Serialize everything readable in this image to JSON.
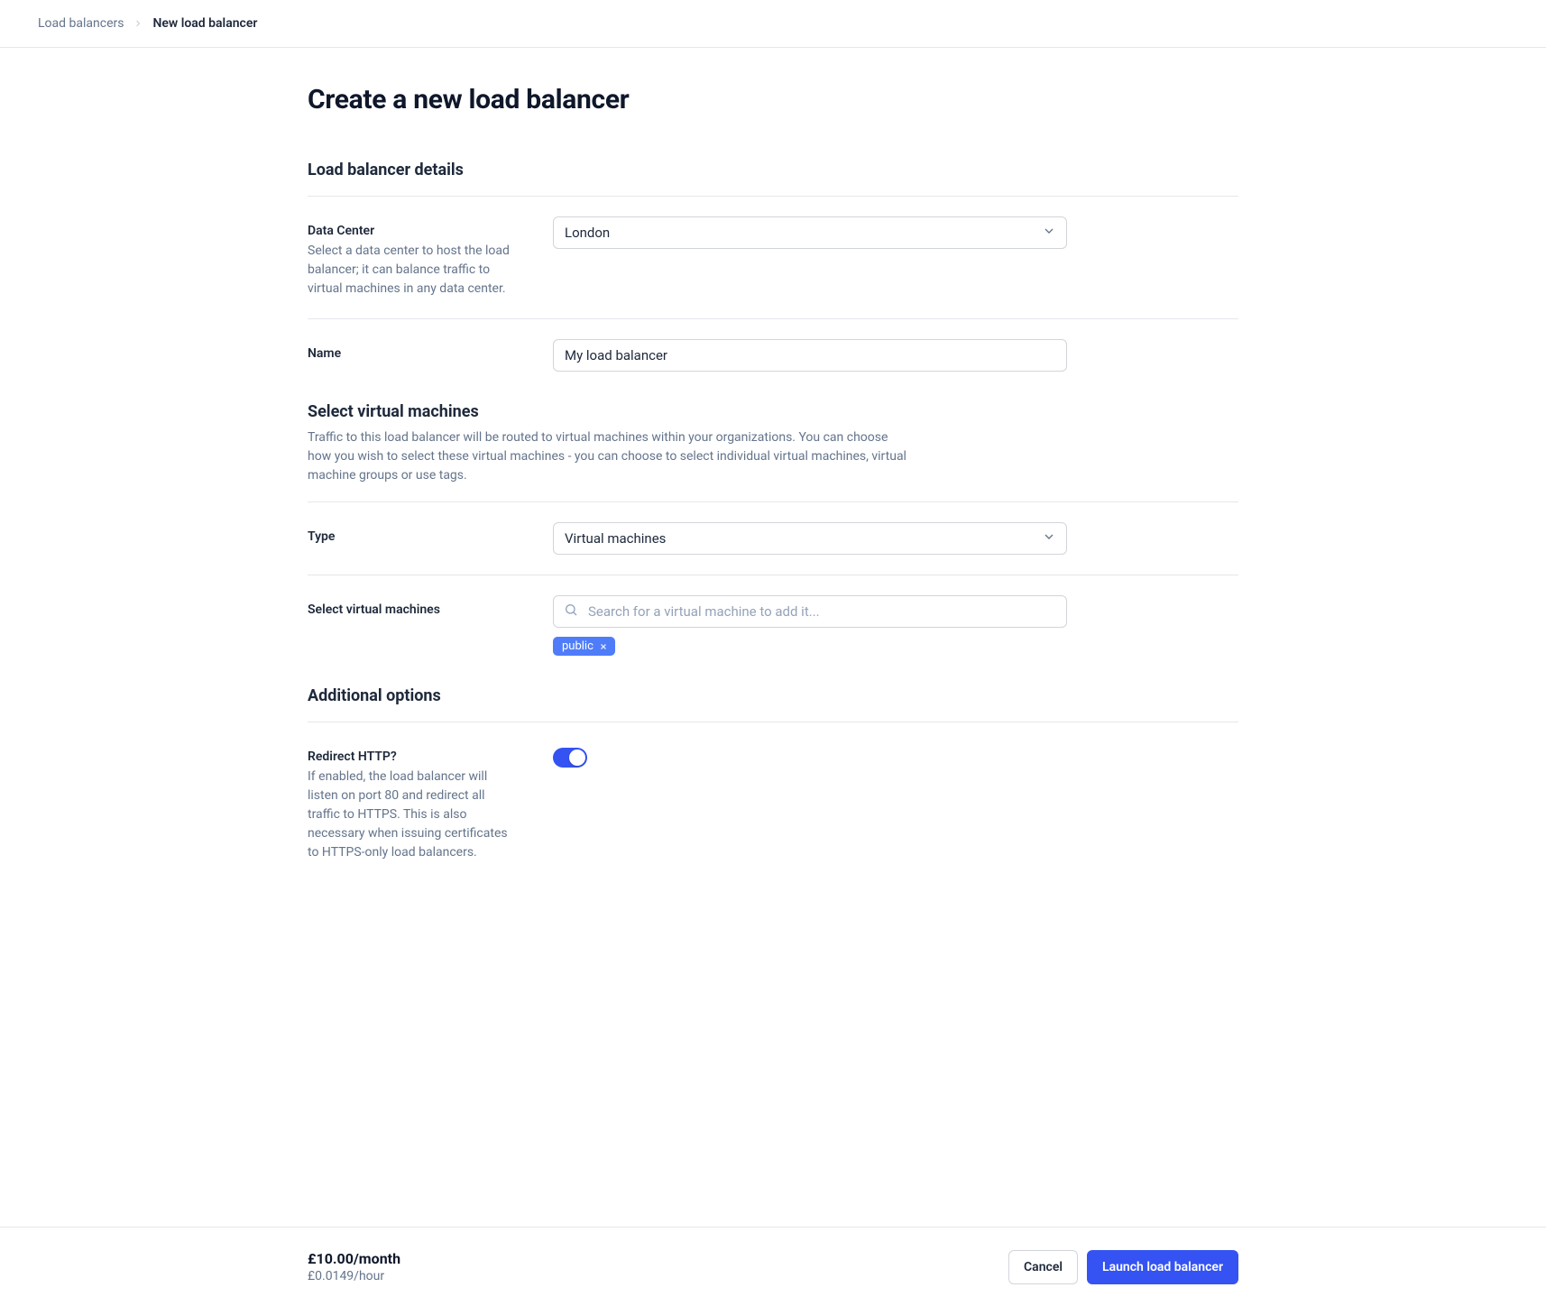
{
  "breadcrumb": {
    "parent": "Load balancers",
    "current": "New load balancer"
  },
  "page_title": "Create a new load balancer",
  "sections": {
    "details": {
      "heading": "Load balancer details",
      "data_center": {
        "label": "Data Center",
        "help": "Select a data center to host the load balancer; it can balance traffic to virtual machines in any data center.",
        "value": "London"
      },
      "name": {
        "label": "Name",
        "value": "My load balancer"
      }
    },
    "vms": {
      "heading": "Select virtual machines",
      "description": "Traffic to this load balancer will be routed to virtual machines within your organizations. You can choose how you wish to select these virtual machines - you can choose to select individual virtual machines, virtual machine groups or use tags.",
      "type": {
        "label": "Type",
        "value": "Virtual machines"
      },
      "select": {
        "label": "Select virtual machines",
        "placeholder": "Search for a virtual machine to add it...",
        "tags": [
          "public"
        ]
      }
    },
    "additional": {
      "heading": "Additional options",
      "redirect": {
        "label": "Redirect HTTP?",
        "help": "If enabled, the load balancer will listen on port 80 and redirect all traffic to HTTPS. This is also necessary when issuing certificates to HTTPS-only load balancers."
      }
    }
  },
  "footer": {
    "price_month": "£10.00/month",
    "price_hour": "£0.0149/hour",
    "cancel": "Cancel",
    "launch": "Launch load balancer"
  }
}
